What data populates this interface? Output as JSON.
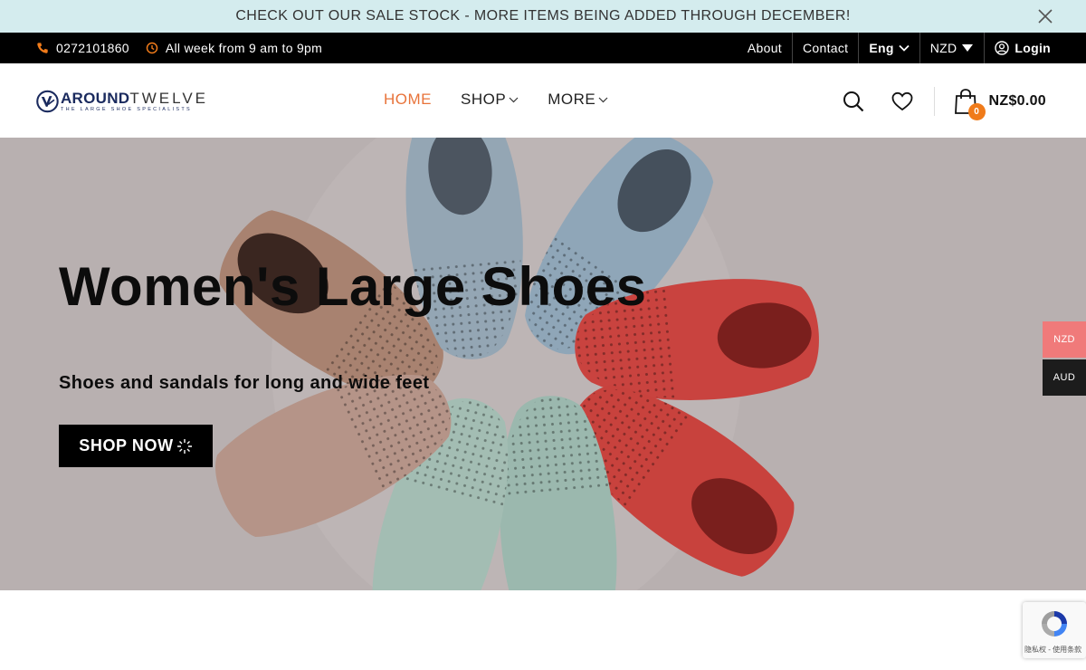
{
  "announcement": {
    "text": "CHECK OUT OUR SALE STOCK - MORE ITEMS BEING ADDED THROUGH DECEMBER!",
    "close_icon": "close-icon"
  },
  "topbar": {
    "phone": "0272101860",
    "hours": "All week from 9 am to 9pm",
    "links": {
      "about": "About",
      "contact": "Contact",
      "language": "Eng",
      "currency": "NZD",
      "login": "Login"
    }
  },
  "header": {
    "logo": {
      "word_bold": "AROUND",
      "word_thin": "TWELVE",
      "tagline": "THE LARGE SHOE SPECIALISTS"
    },
    "nav": {
      "home": "HOME",
      "shop": "SHOP",
      "more": "MORE"
    },
    "cart": {
      "count": "0",
      "total": "NZ$0.00"
    }
  },
  "hero": {
    "title": "Women's Large Shoes",
    "subtitle": "Shoes and sandals for long and wide feet",
    "button": "SHOP NOW"
  },
  "currency_switcher": {
    "nzd": "NZD",
    "aud": "AUD"
  },
  "recaptcha": {
    "text": "隐私权 - 使用条款"
  },
  "colors": {
    "announce_bg": "#d4ecee",
    "accent_orange": "#e8733a",
    "badge_orange": "#f07b1a",
    "nzd_pink": "#f07a7a",
    "hero_bg": "#b8b0b0"
  }
}
